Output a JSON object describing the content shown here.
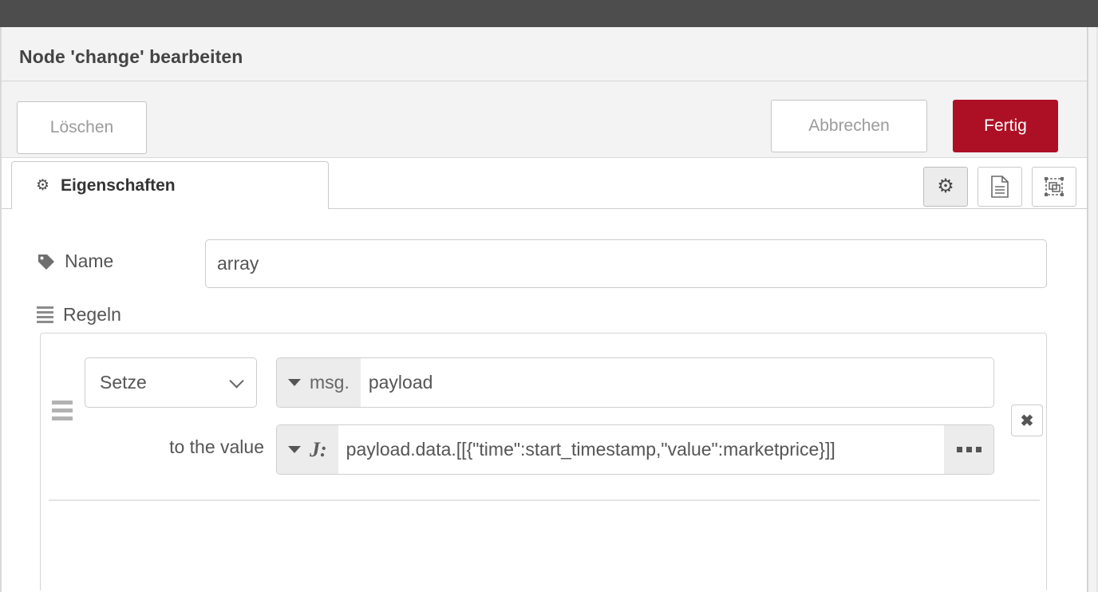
{
  "window": {
    "topbar_color": "#4d4d4d",
    "accent_color": "#ad1025"
  },
  "dialog": {
    "title": "Node 'change' bearbeiten",
    "buttons": {
      "delete_label": "Löschen",
      "cancel_label": "Abbrechen",
      "done_label": "Fertig"
    }
  },
  "tabs": [
    {
      "label": "Eigenschaften",
      "icon": "gear-icon",
      "active": true
    }
  ],
  "tool_buttons": [
    {
      "icon": "gear-icon",
      "active": true
    },
    {
      "icon": "description-icon",
      "active": false
    },
    {
      "icon": "appearance-icon",
      "active": false
    }
  ],
  "form": {
    "name": {
      "label": "Name",
      "icon": "tag-icon",
      "value": "array",
      "placeholder": "Name"
    },
    "rules": {
      "label": "Regeln",
      "icon": "list-icon",
      "items": [
        {
          "action": "Setze",
          "property_type": "msg.",
          "property": "payload",
          "to_label": "to the value",
          "value_type": "J:",
          "value": "payload.data.[[{\"time\":start_timestamp,\"value\":marketprice}]]",
          "expand_label": "•••",
          "remove_label": "✖"
        }
      ]
    }
  }
}
